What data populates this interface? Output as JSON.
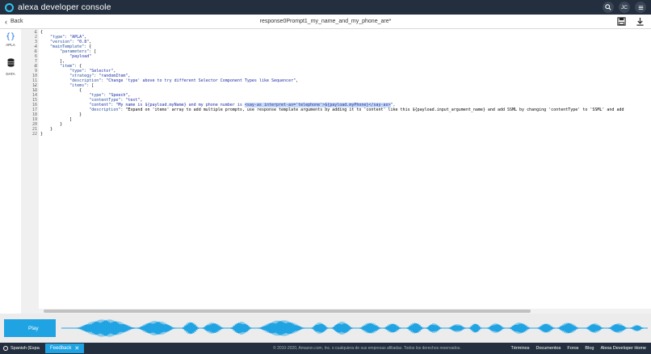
{
  "header": {
    "app_title": "alexa developer console",
    "user_initials": "JC",
    "icons": [
      "search-icon",
      "user-avatar"
    ]
  },
  "subheader": {
    "back_label": "Back",
    "document_title": "response0Prompt1_my_name_and_my_phone_are*",
    "icons": [
      "save-icon",
      "download-icon"
    ]
  },
  "sidebar": {
    "items": [
      {
        "label": "APLA",
        "icon": "braces-icon"
      },
      {
        "label": "DATA",
        "icon": "database-icon"
      }
    ]
  },
  "editor": {
    "line_numbers": [
      "1",
      "2",
      "3",
      "4",
      "5",
      "6",
      "7",
      "8",
      "9",
      "10",
      "11",
      "12",
      "13",
      "14",
      "15",
      "16",
      "17",
      "18",
      "19",
      "20",
      "21",
      "22"
    ],
    "lines": [
      "{",
      "    \"type\": \"APLA\",",
      "    \"version\": \"0.8\",",
      "    \"mainTemplate\": {",
      "        \"parameters\": [",
      "            \"payload\"",
      "        ],",
      "        \"item\": {",
      "            \"type\": \"Selector\",",
      "            \"strategy\": \"randomItem\",",
      "            \"description\": \"Change 'type' above to try different Selector Component Types like Sequencer\",",
      "            \"items\": [",
      "                {",
      "                    \"type\": \"Speech\",",
      "                    \"contentType\": \"text\",",
      "                    \"content\": \"My name is ${payload.myName} and my phone number is <say-as interpret-as='telephone'>${payload.myPhone}</say-as>\",",
      "                    \"description\": \"Expand on 'items' array to add multiple prompts, use response template arguments by adding it to 'content' like this ${payload.input_argument_name} and add SSML by changing 'contentType' to 'SSML' and add",
      "                }",
      "            ]",
      "        }",
      "    }",
      "}"
    ],
    "highlighted_text": "<say-as interpret-as='telephone'>${payload.myPhone}</say-as>",
    "active_line": 16
  },
  "player": {
    "play_label": "Play"
  },
  "footer": {
    "language": "Spanish (Espa",
    "feedback_label": "Feedback",
    "copyright": "© 2010-2020, Amazon.com, Inc. o cualquiera de sus empresas afiliadas. Todos los derechos reservados.",
    "links": [
      "Términos",
      "Documentos",
      "Foros",
      "Blog",
      "Alexa Developer Home"
    ]
  },
  "colors": {
    "topbar": "#232f3e",
    "accent": "#1fa3e3",
    "logo_ring": "#31c4f3",
    "selection": "#c7d9f5"
  }
}
